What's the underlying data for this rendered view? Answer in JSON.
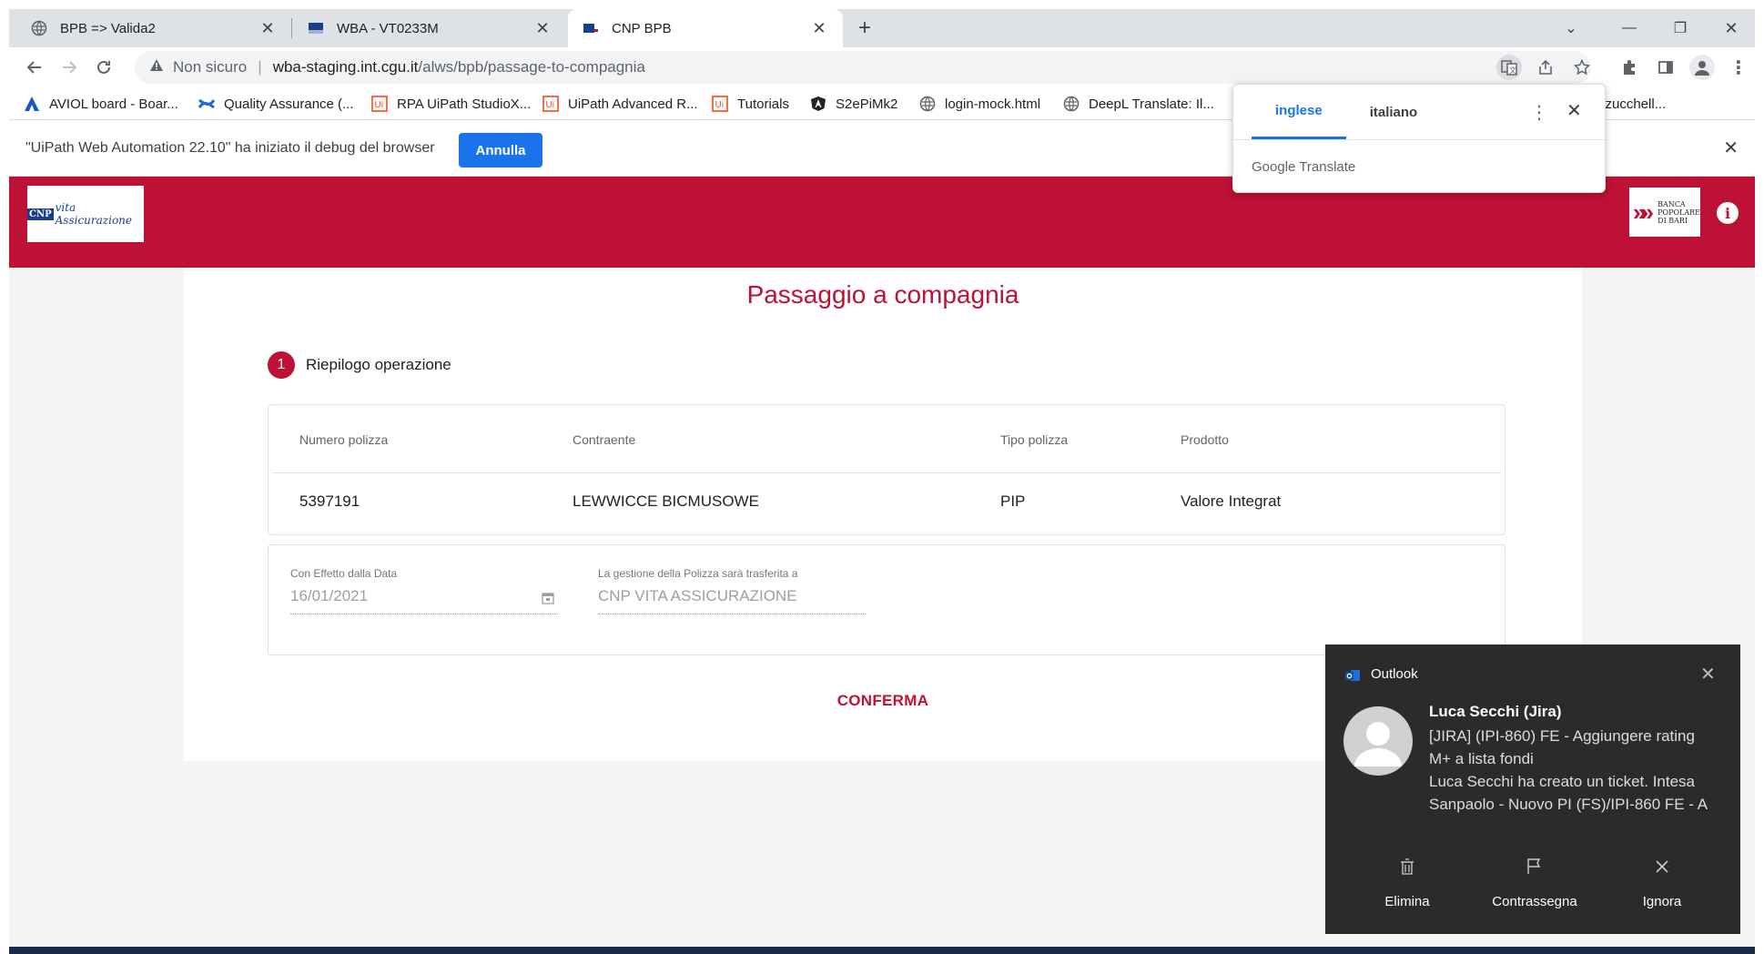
{
  "browser": {
    "tabs": [
      {
        "title": "BPB => Valida2"
      },
      {
        "title": "WBA - VT0233M"
      },
      {
        "title": "CNP BPB"
      }
    ],
    "new_tab": "+",
    "address": {
      "security": "Non sicuro",
      "host": "wba-staging.int.cgu.it",
      "path": "/alws/bpb/passage-to-compagnia"
    },
    "bookmarks": [
      {
        "label": "AVIOL board - Boar...",
        "icon": "aviol-icon"
      },
      {
        "label": "Quality Assurance (...",
        "icon": "confluence-icon"
      },
      {
        "label": "RPA UiPath StudioX...",
        "icon": "uipath-icon"
      },
      {
        "label": "UiPath Advanced R...",
        "icon": "uipath-icon"
      },
      {
        "label": "Tutorials",
        "icon": "uipath-icon"
      },
      {
        "label": "S2ePiMk2",
        "icon": "angular-icon"
      },
      {
        "label": "login-mock.html",
        "icon": "globe-icon"
      },
      {
        "label": "DeepL Translate: Il...",
        "icon": "globe-icon"
      },
      {
        "label": "zzucchell...",
        "icon": ""
      }
    ],
    "debug_bar": {
      "text": "\"UiPath Web Automation 22.10\" ha iniziato il debug del browser",
      "button": "Annulla"
    }
  },
  "translate_popup": {
    "tabs": [
      "inglese",
      "italiano"
    ],
    "selected": "inglese",
    "brand_google": "Google",
    "brand_translate": "Translate"
  },
  "app": {
    "title": "Passaggio a compagnia",
    "step": {
      "number": "1",
      "label": "Riepilogo operazione"
    },
    "table": {
      "headers": [
        "Numero polizza",
        "Contraente",
        "Tipo polizza",
        "Prodotto"
      ],
      "row": [
        "5397191",
        "LEWWICCE BICMUSOWE",
        "PIP",
        "Valore Integrat"
      ]
    },
    "form": {
      "date_label": "Con Effetto dalla Data",
      "date_value": "16/01/2021",
      "company_label": "La gestione della Polizza sarà trasferita a",
      "company_value": "CNP VITA ASSICURAZIONE"
    },
    "confirm": "CONFERMA",
    "logo_left": {
      "mark": "CNP",
      "text": "vita Assicurazione"
    },
    "logo_right": {
      "text": [
        "BANCA",
        "POPOLARE",
        "DI BARI"
      ]
    }
  },
  "notification": {
    "app": "Outlook",
    "sender": "Luca Secchi (Jira)",
    "lines": [
      "[JIRA] (IPI-860) FE - Aggiungere rating",
      "M+ a lista fondi",
      "Luca Secchi ha creato un ticket. Intesa",
      "Sanpaolo - Nuovo PI (FS)/IPI-860 FE - A"
    ],
    "actions": [
      "Elimina",
      "Contrassegna",
      "Ignora"
    ]
  },
  "colors": {
    "brand": "#be1136",
    "chrome_blue": "#1a73e8"
  }
}
